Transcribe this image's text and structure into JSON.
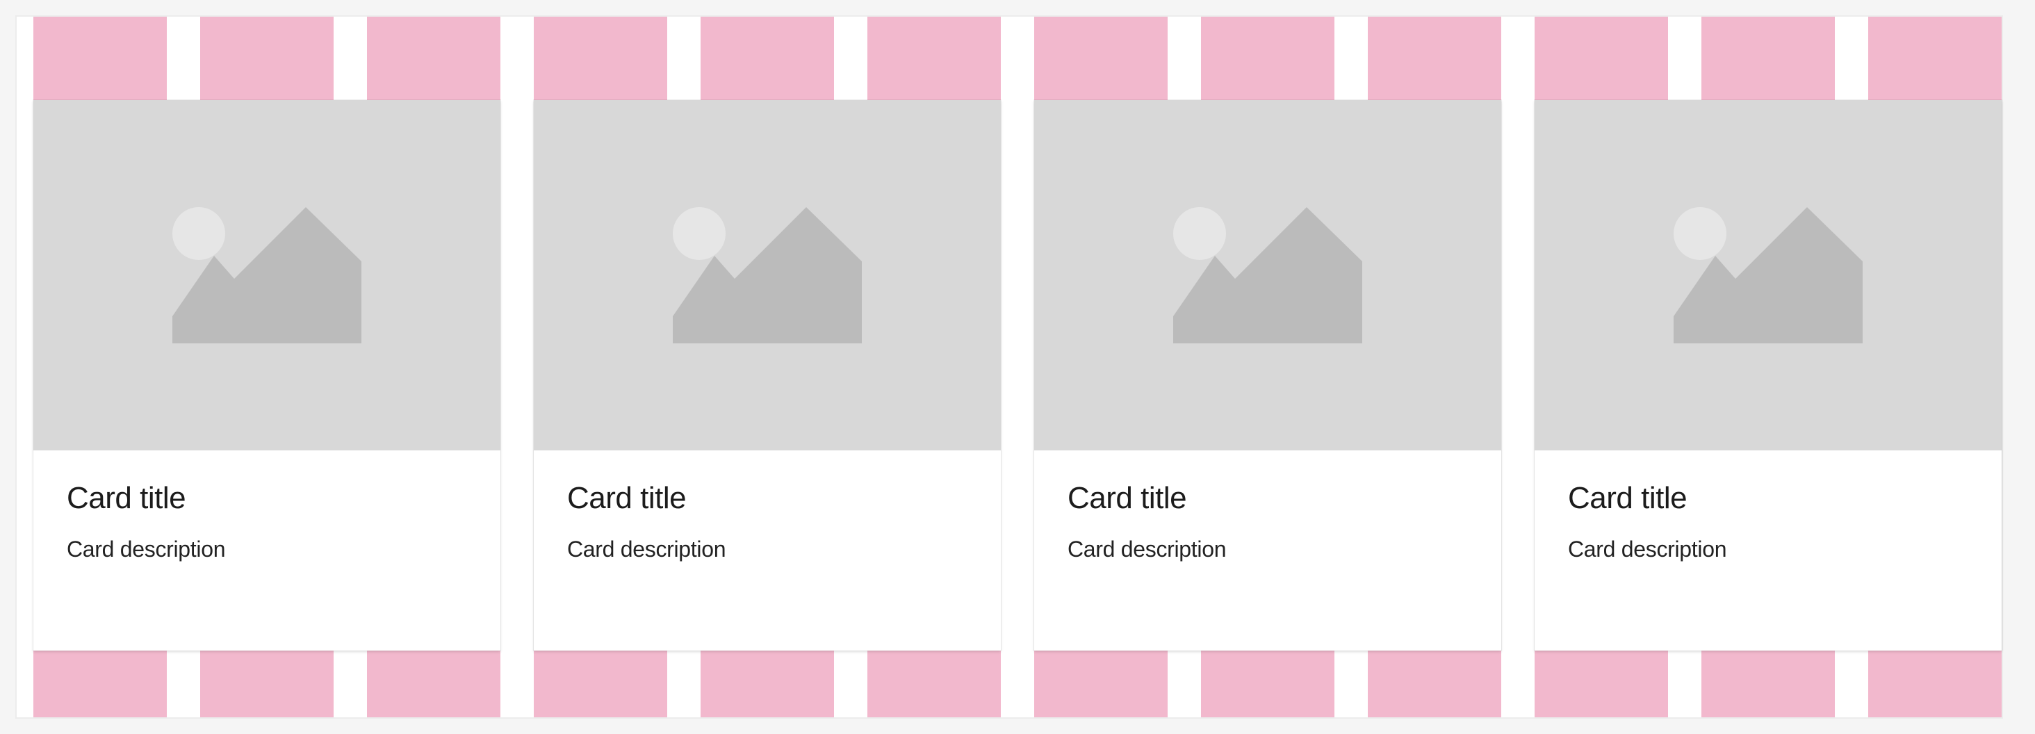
{
  "theme": {
    "page_background": "#f5f5f5",
    "grid_column_color": "#f2b8cd",
    "image_placeholder_bg": "#d8d8d8",
    "image_placeholder_shape": "#bbbbbb",
    "image_placeholder_sun": "#e6e6e6"
  },
  "grid": {
    "columns": 12
  },
  "cards": [
    {
      "title": "Card title",
      "description": "Card description",
      "image_icon": "image-placeholder-icon"
    },
    {
      "title": "Card title",
      "description": "Card description",
      "image_icon": "image-placeholder-icon"
    },
    {
      "title": "Card title",
      "description": "Card description",
      "image_icon": "image-placeholder-icon"
    },
    {
      "title": "Card title",
      "description": "Card description",
      "image_icon": "image-placeholder-icon"
    }
  ]
}
